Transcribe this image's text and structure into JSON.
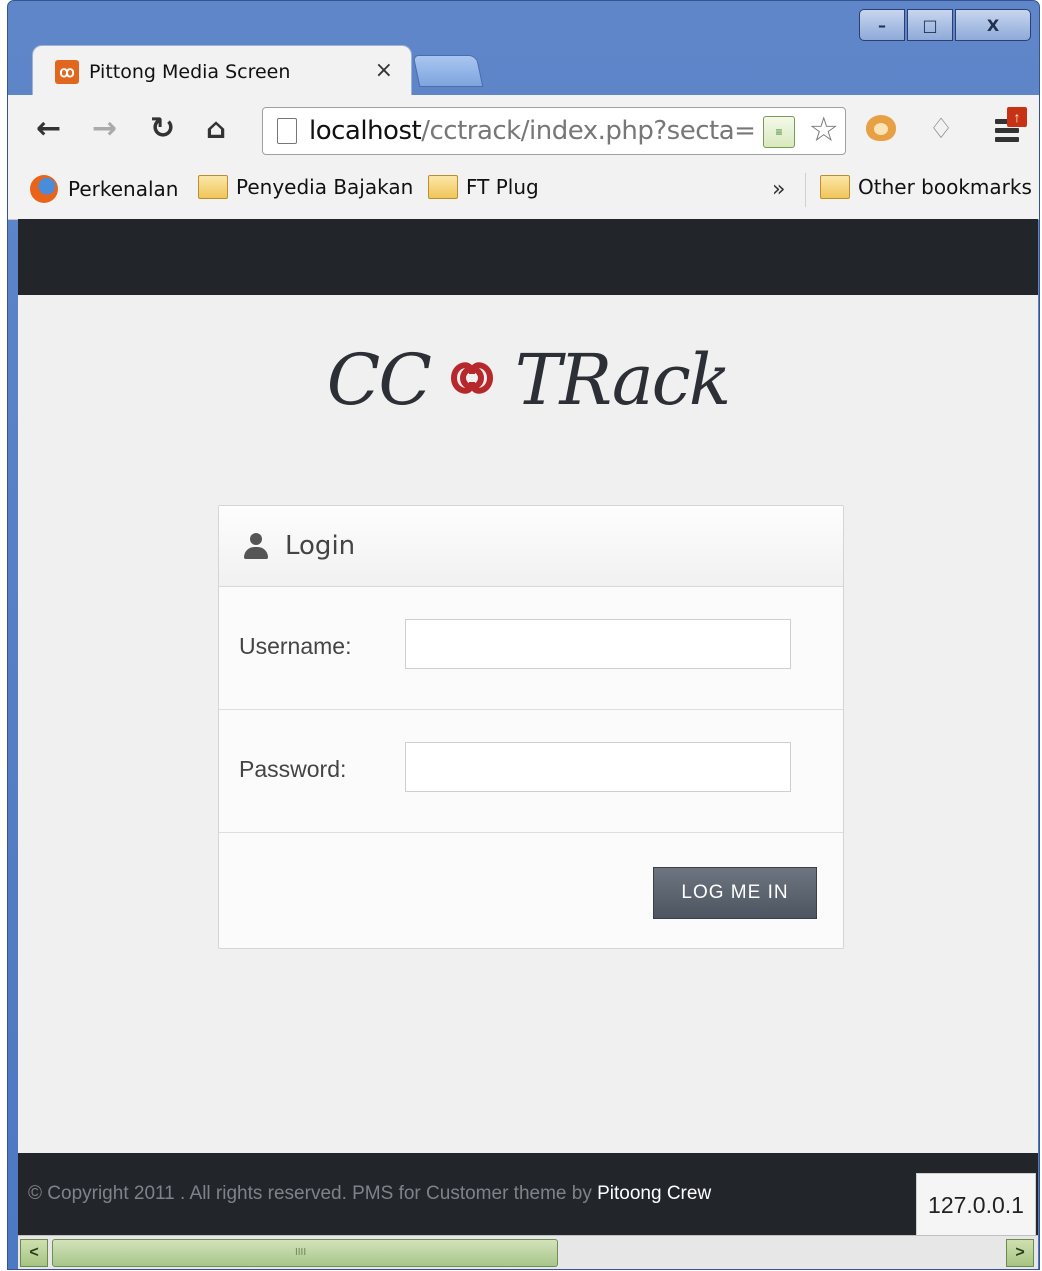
{
  "browser": {
    "tab_title": "Pittong Media Screen",
    "tab_close": "×",
    "favicon_glyph": "ꝏ",
    "url_host": "localhost",
    "url_rest": "/cctrack/index.php?secta=lo",
    "icons": {
      "back": "back-arrow-icon",
      "forward": "forward-arrow-icon",
      "reload": "reload-icon",
      "home": "home-icon",
      "page": "page-icon",
      "rss": "rss-icon",
      "star": "star-icon",
      "extension": "monkey-face-icon",
      "notifications": "bell-icon",
      "menu": "wrench-menu-icon"
    },
    "window_controls": {
      "minimize": "–",
      "restore": "□",
      "close": "X"
    }
  },
  "bookmarks": {
    "items": [
      {
        "label": "Perkenalan"
      },
      {
        "label": "Penyedia Bajakan"
      },
      {
        "label": "FT Plug"
      }
    ],
    "overflow": "»",
    "other": "Other bookmarks"
  },
  "page": {
    "logo_left": "CC",
    "logo_right": "TRack",
    "logo_accent_color": "#b6282b",
    "login": {
      "title": "Login",
      "username_label": "Username:",
      "username_value": "",
      "password_label": "Password:",
      "password_value": "",
      "submit_label": "LOG ME IN"
    },
    "footer": {
      "copyright": "© Copyright 2011 . All rights reserved. PMS for Customer theme by ",
      "crew": "Pitoong Crew",
      "ip": "127.0.0.1"
    }
  },
  "scrollbar": {
    "left": "<",
    "right": ">",
    "grip": "IIII"
  }
}
